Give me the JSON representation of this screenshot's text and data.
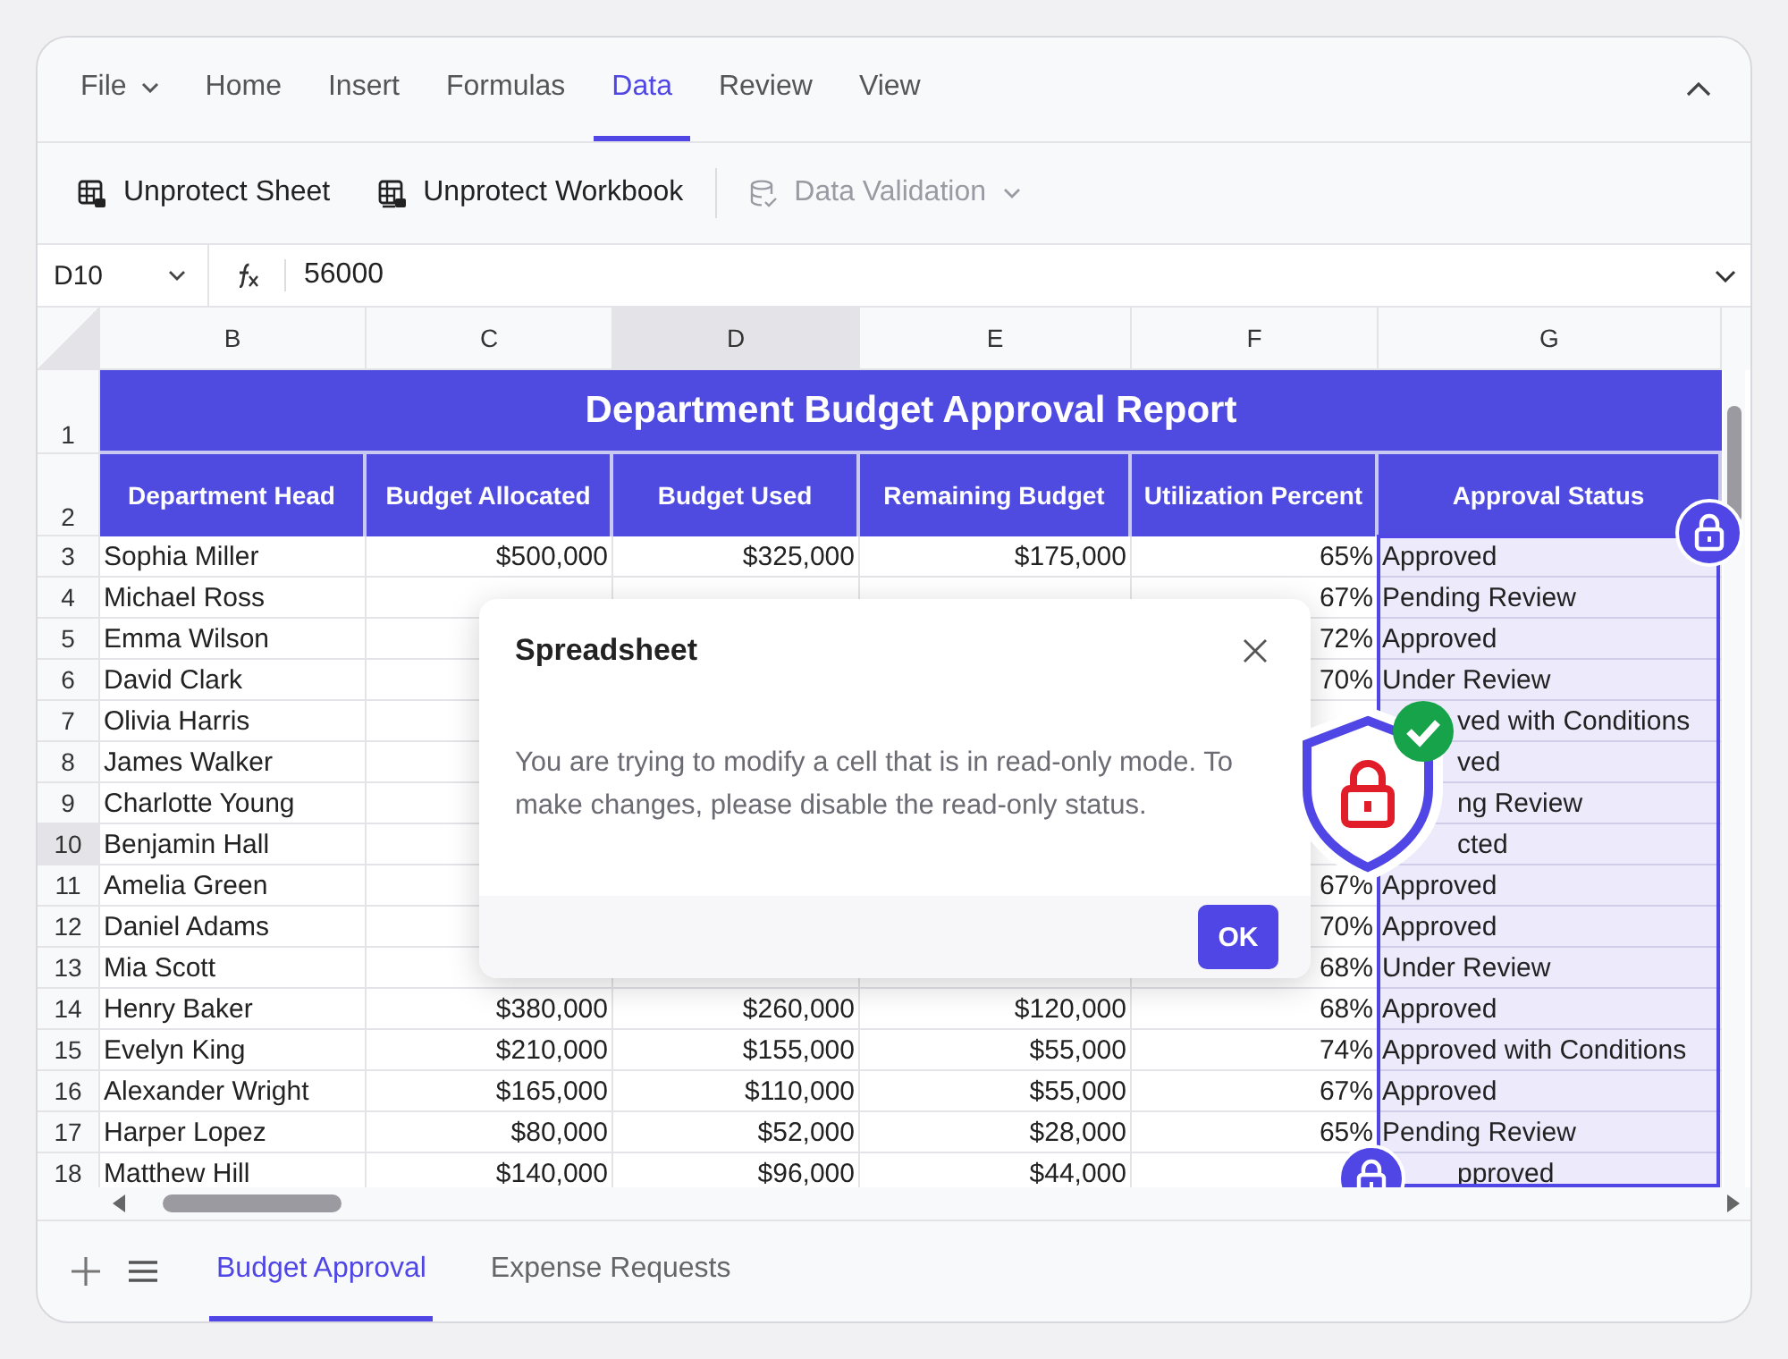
{
  "file_menu": {
    "label": "File"
  },
  "ribbon_tabs": [
    {
      "label": "Home",
      "selected": false
    },
    {
      "label": "Insert",
      "selected": false
    },
    {
      "label": "Formulas",
      "selected": false
    },
    {
      "label": "Data",
      "selected": true
    },
    {
      "label": "Review",
      "selected": false
    },
    {
      "label": "View",
      "selected": false
    }
  ],
  "toolbar": [
    {
      "label": "Unprotect Sheet",
      "disabled": false,
      "kind": "sheet"
    },
    {
      "label": "Unprotect Workbook",
      "disabled": false,
      "kind": "workbook"
    },
    {
      "label": "Data Validation",
      "disabled": true,
      "kind": "validation"
    }
  ],
  "formula_bar": {
    "cell_ref": "D10",
    "value": "56000"
  },
  "sheet": {
    "columns": [
      {
        "label": "B",
        "selected": false,
        "range_selected": false
      },
      {
        "label": "C",
        "selected": false,
        "range_selected": false
      },
      {
        "label": "D",
        "selected": true,
        "range_selected": false
      },
      {
        "label": "E",
        "selected": false,
        "range_selected": false
      },
      {
        "label": "F",
        "selected": false,
        "range_selected": false
      },
      {
        "label": "G",
        "selected": false,
        "range_selected": true
      }
    ],
    "title_row": "1",
    "title": "Department Budget Approval Report",
    "header_row": "2",
    "headers": [
      "Department Head",
      "Budget Allocated",
      "Budget Used",
      "Remaining Budget",
      "Utilization Percent",
      "Approval Status"
    ],
    "rows": [
      {
        "number": "3",
        "selected": false,
        "cells": [
          "Sophia Miller",
          "$500,000",
          "$325,000",
          "$175,000",
          "65%",
          "Approved"
        ]
      },
      {
        "number": "4",
        "selected": false,
        "cells": [
          "Michael Ross",
          null,
          null,
          null,
          "67%",
          "Pending Review"
        ]
      },
      {
        "number": "5",
        "selected": false,
        "cells": [
          "Emma Wilson",
          null,
          null,
          null,
          "72%",
          "Approved"
        ]
      },
      {
        "number": "6",
        "selected": false,
        "cells": [
          "David Clark",
          null,
          null,
          null,
          "70%",
          "Under Review"
        ]
      },
      {
        "number": "7",
        "selected": false,
        "cells": [
          "Olivia Harris",
          null,
          null,
          null,
          null,
          "ved with Conditions"
        ]
      },
      {
        "number": "8",
        "selected": false,
        "cells": [
          "James Walker",
          null,
          null,
          null,
          null,
          "ved"
        ]
      },
      {
        "number": "9",
        "selected": false,
        "cells": [
          "Charlotte Young",
          null,
          null,
          null,
          null,
          "ng Review"
        ]
      },
      {
        "number": "10",
        "selected": true,
        "cells": [
          "Benjamin Hall",
          null,
          null,
          null,
          null,
          "cted"
        ]
      },
      {
        "number": "11",
        "selected": false,
        "cells": [
          "Amelia Green",
          null,
          null,
          null,
          "67%",
          "Approved"
        ]
      },
      {
        "number": "12",
        "selected": false,
        "cells": [
          "Daniel Adams",
          null,
          null,
          null,
          "70%",
          "Approved"
        ]
      },
      {
        "number": "13",
        "selected": false,
        "cells": [
          "Mia Scott",
          null,
          null,
          null,
          "68%",
          "Under Review"
        ]
      },
      {
        "number": "14",
        "selected": false,
        "cells": [
          "Henry Baker",
          "$380,000",
          "$260,000",
          "$120,000",
          "68%",
          "Approved"
        ]
      },
      {
        "number": "15",
        "selected": false,
        "cells": [
          "Evelyn King",
          "$210,000",
          "$155,000",
          "$55,000",
          "74%",
          "Approved with Conditions"
        ]
      },
      {
        "number": "16",
        "selected": false,
        "cells": [
          "Alexander Wright",
          "$165,000",
          "$110,000",
          "$55,000",
          "67%",
          "Approved"
        ]
      },
      {
        "number": "17",
        "selected": false,
        "cells": [
          "Harper Lopez",
          "$80,000",
          "$52,000",
          "$28,000",
          "65%",
          "Pending Review"
        ]
      },
      {
        "number": "18",
        "selected": false,
        "cells": [
          "Matthew Hill",
          "$140,000",
          "$96,000",
          "$44,000",
          null,
          "pproved"
        ]
      }
    ]
  },
  "dialog": {
    "title": "Spreadsheet",
    "message": "You are trying to modify a cell that is in read-only mode. To make changes, please disable the read-only status.",
    "button": "OK"
  },
  "sheet_tabs": [
    {
      "label": "Budget Approval",
      "selected": true
    },
    {
      "label": "Expense Requests",
      "selected": false
    }
  ]
}
